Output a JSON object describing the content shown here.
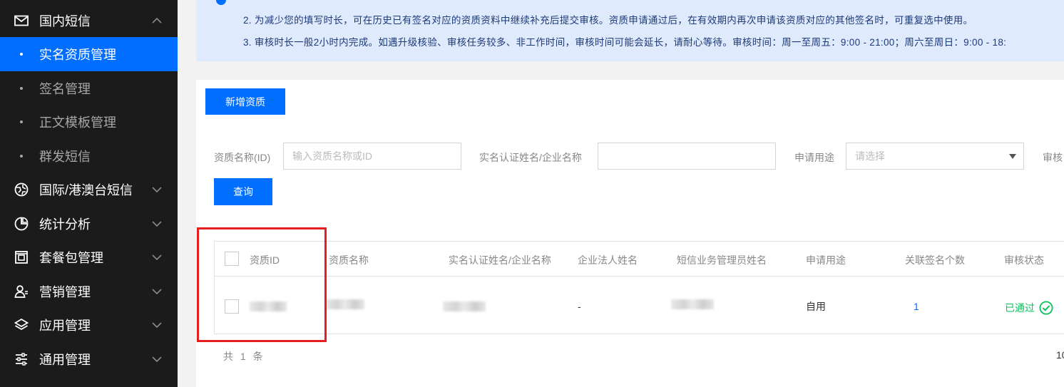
{
  "sidebar": {
    "groups": [
      {
        "label": "国内短信",
        "icon": "mail-icon",
        "expanded": true
      },
      {
        "label": "国际/港澳台短信",
        "icon": "globe-icon"
      },
      {
        "label": "统计分析",
        "icon": "pie-chart-icon"
      },
      {
        "label": "套餐包管理",
        "icon": "package-icon"
      },
      {
        "label": "营销管理",
        "icon": "users-icon"
      },
      {
        "label": "应用管理",
        "icon": "layers-icon"
      },
      {
        "label": "通用管理",
        "icon": "sliders-icon"
      }
    ],
    "subitems": [
      {
        "label": "实名资质管理",
        "active": true
      },
      {
        "label": "签名管理"
      },
      {
        "label": "正文模板管理"
      },
      {
        "label": "群发短信"
      }
    ]
  },
  "notice": {
    "line2": "2. 为减少您的填写时长，可在历史已有签名对应的资质资料中继续补充后提交审核。资质申请通过后，在有效期内再次申请该资质对应的其他签名时，可重复选中使用。",
    "line3": "3. 审核时长一般2小时内完成。如遇升级核验、审核任务较多、非工作时间，审核时间可能会延长，请耐心等待。审核时间：周一至周五：9:00 - 21:00；周六至周日：9:00 - 18:"
  },
  "toolbar": {
    "add_label": "新增资质"
  },
  "filters": {
    "name_label": "资质名称(ID)",
    "name_placeholder": "输入资质名称或ID",
    "realname_label": "实名认证姓名/企业名称",
    "realname_value": "",
    "purpose_label": "申请用途",
    "purpose_placeholder": "请选择",
    "review_label": "审核",
    "query_label": "查询"
  },
  "table": {
    "columns": [
      "资质ID",
      "资质名称",
      "实名认证姓名/企业名称",
      "企业法人姓名",
      "短信业务管理员姓名",
      "申请用途",
      "关联签名个数",
      "审核状态"
    ],
    "rows": [
      {
        "legal_person": "-",
        "purpose": "自用",
        "sign_count": "1",
        "status": "已通过"
      }
    ]
  },
  "footer": {
    "total": "共 1 条",
    "page_size": "10"
  },
  "colors": {
    "primary": "#006eff",
    "success": "#0abf5b",
    "highlight": "#e51e1e",
    "sidebar": "#1b1b1b"
  }
}
